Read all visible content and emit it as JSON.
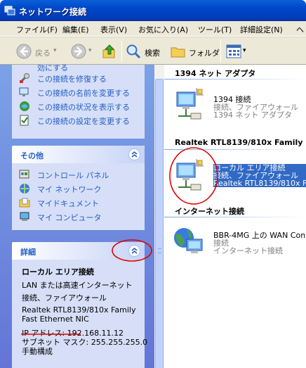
{
  "window": {
    "title": "ネットワーク接続"
  },
  "menu": [
    "ファイル(F)",
    "編集(E)",
    "表示(V)",
    "お気に入り(A)",
    "ツール(T)",
    "詳細設定(N)",
    "ヘ"
  ],
  "toolbar": {
    "back": "戻る",
    "search": "検索",
    "folders": "フォルダ"
  },
  "taskpane": {
    "network_tasks": {
      "partial": "効にする",
      "items": [
        "この接続を修復する",
        "この接続の名前を変更する",
        "この接続の状況を表示する",
        "この接続の設定を変更する"
      ]
    },
    "other": {
      "title": "その他",
      "items": [
        "コントロール パネル",
        "マイ ネットワーク",
        "マイドキュメント",
        "マイ コンピュータ"
      ]
    },
    "details": {
      "title": "詳細",
      "name": "ローカル エリア接続",
      "lines": [
        "LAN または高速インターネット",
        "接続、ファイアウォール",
        "Realtek RTL8139/810x Family",
        "Fast Ethernet NIC",
        "IP アドレス: 192.168.11.12",
        "サブネット マスク: 255.255.255.0",
        "手動構成"
      ]
    }
  },
  "groups": [
    {
      "title": "1394 ネット アダプタ",
      "connections": [
        {
          "name": "1394 接続",
          "status": "接続、ファイアウォール",
          "device": "1394 ネット アダプタ"
        }
      ]
    },
    {
      "title": "Realtek RTL8139/810x Family",
      "connections": [
        {
          "name": "ローカル エリア接続",
          "status": "接続、ファイアウォール",
          "device": "Realtek RTL8139/810x Fa"
        }
      ]
    },
    {
      "title": "インターネット接続",
      "connections": [
        {
          "name": "BBR-4MG 上の WAN Con",
          "status": "接続",
          "device": "インターネット接続"
        }
      ]
    }
  ],
  "colors": {
    "titlebar": "#0046c8",
    "taskpane": "#6375d6",
    "link": "#215dc6",
    "selection": "#316ac5",
    "annotation": "#e00000"
  }
}
